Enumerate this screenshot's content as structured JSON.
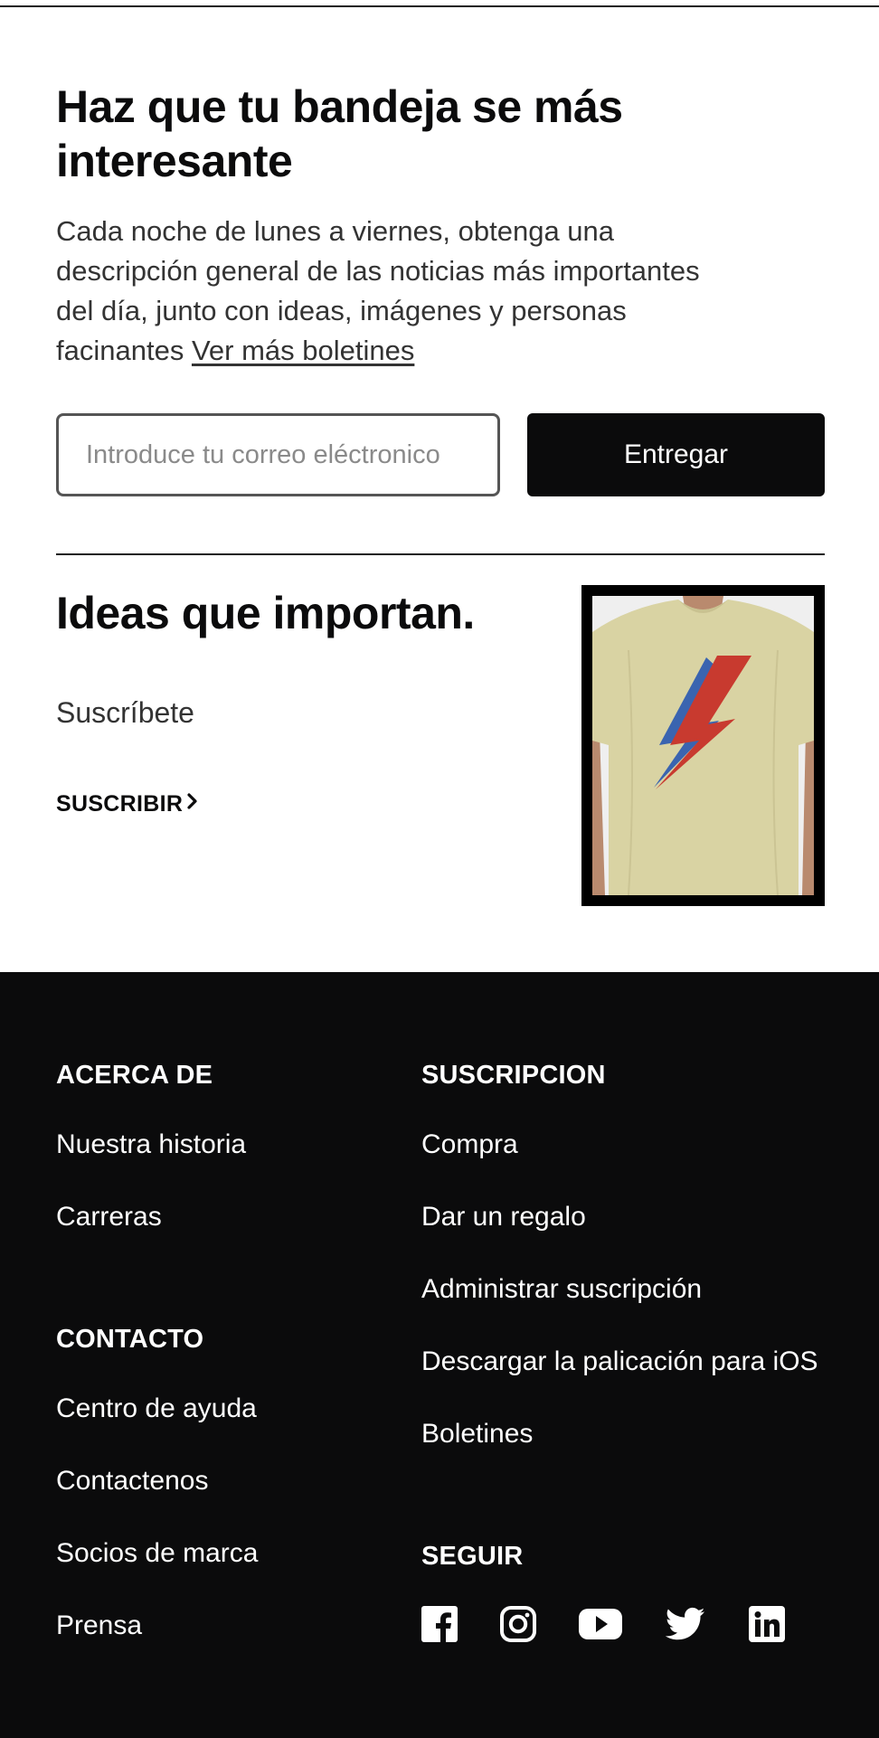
{
  "newsletter": {
    "title": "Haz que tu bandeja se más interesante",
    "description": "Cada noche de lunes a viernes, obtenga una descripción general de las noticias más importantes del día, junto con ideas, imágenes y personas facinantes",
    "more_link": "Ver más boletines",
    "email_placeholder": "Introduce tu correo eléctronico",
    "email_value": "",
    "submit_label": "Entregar"
  },
  "promo": {
    "title": "Ideas que importan.",
    "subtitle": "Suscríbete",
    "cta_label": "SUSCRIBIR",
    "cta_icon": "chevron-right-icon",
    "image": "t-shirt-lightning-bolt"
  },
  "footer": {
    "about": {
      "heading": "ACERCA DE",
      "links": [
        "Nuestra historia",
        "Carreras"
      ]
    },
    "contact": {
      "heading": "CONTACTO",
      "links": [
        "Centro de ayuda",
        "Contactenos",
        "Socios de marca",
        "Prensa"
      ]
    },
    "subscription": {
      "heading": "SUSCRIPCION",
      "links": [
        "Compra",
        "Dar un regalo",
        "Administrar suscripción",
        "Descargar la palicación para iOS",
        "Boletines"
      ]
    },
    "follow": {
      "heading": "SEGUIR",
      "icons": [
        "facebook-icon",
        "instagram-icon",
        "youtube-icon",
        "twitter-icon",
        "linkedin-icon"
      ]
    }
  },
  "colors": {
    "background": "#ffffff",
    "text": "#0b0b0c",
    "muted_text": "#333333",
    "footer_bg": "#0b0b0c",
    "button_bg": "#0b0b0c",
    "bolt_red": "#c83a2f",
    "bolt_blue": "#3a64b0",
    "shirt": "#d9d3a3"
  }
}
